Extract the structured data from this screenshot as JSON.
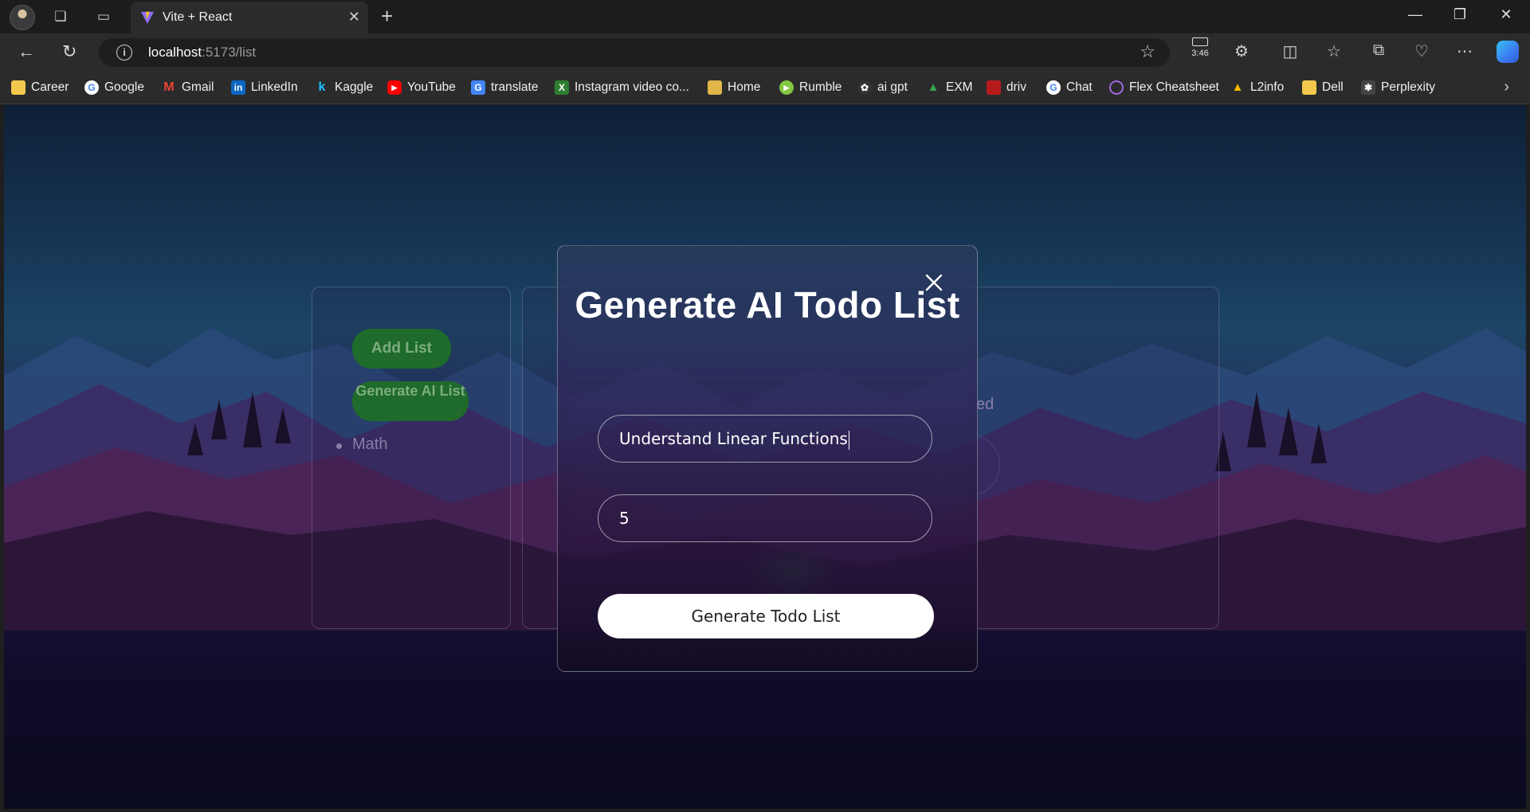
{
  "browser": {
    "tab_title": "Vite + React",
    "url_host": "localhost",
    "url_rest": ":5173/list",
    "battery_time": "3:46"
  },
  "bookmarks": [
    {
      "label": "Career",
      "icon": "folder-icon",
      "color": "#f2c94c"
    },
    {
      "label": "Google",
      "icon": "google-icon",
      "color": "#4285f4"
    },
    {
      "label": "Gmail",
      "icon": "gmail-icon",
      "color": "#ea4335"
    },
    {
      "label": "LinkedIn",
      "icon": "linkedin-icon",
      "color": "#0a66c2"
    },
    {
      "label": "Kaggle",
      "icon": "kaggle-icon",
      "color": "#20beff"
    },
    {
      "label": "YouTube",
      "icon": "youtube-icon",
      "color": "#ff0000"
    },
    {
      "label": "translate",
      "icon": "translate-icon",
      "color": "#4285f4"
    },
    {
      "label": "Instagram video co...",
      "icon": "instagram-tool-icon",
      "color": "#2e7d32"
    },
    {
      "label": "Home",
      "icon": "home-icon",
      "color": "#e0b64a"
    },
    {
      "label": "Rumble",
      "icon": "rumble-icon",
      "color": "#85c742"
    },
    {
      "label": "ai gpt",
      "icon": "openai-icon",
      "color": "#444444"
    },
    {
      "label": "EXM",
      "icon": "drive-icon",
      "color": "#34a853"
    },
    {
      "label": "driv",
      "icon": "driv-icon",
      "color": "#b71c1c"
    },
    {
      "label": "Chat",
      "icon": "google-chat-icon",
      "color": "#4285f4"
    },
    {
      "label": "Flex Cheatsheet",
      "icon": "flex-icon",
      "color": "#9c6ade"
    },
    {
      "label": "L2info",
      "icon": "drive-icon",
      "color": "#fbbc04"
    },
    {
      "label": "Dell",
      "icon": "folder-icon",
      "color": "#f2c94c"
    },
    {
      "label": "Perplexity",
      "icon": "perplexity-icon",
      "color": "#555555"
    }
  ],
  "page": {
    "left_card": {
      "add_list_label": "Add List",
      "generate_ai_list_label": "Generate AI List",
      "lists": [
        "Math"
      ]
    },
    "right_card_partial_text": "ed"
  },
  "modal": {
    "title": "Generate AI Todo List",
    "topic_value": "Understand Linear Functions",
    "count_value": "5",
    "submit_label": "Generate Todo List"
  }
}
